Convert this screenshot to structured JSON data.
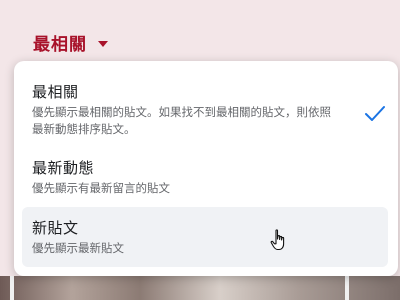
{
  "sort_menu": {
    "selected_label": "最相關",
    "options": [
      {
        "label": "最相關",
        "description": "優先顯示最相關的貼文。如果找不到最相關的貼文，則依照最新動態排序貼文。",
        "selected": true
      },
      {
        "label": "最新動態",
        "description": "優先顯示有最新留言的貼文",
        "selected": false
      },
      {
        "label": "新貼文",
        "description": "優先顯示最新貼文",
        "selected": false,
        "hovered": true
      }
    ]
  },
  "icons": {
    "caret": "chevron-down-icon",
    "check": "check-icon",
    "cursor": "hand-pointer-icon"
  },
  "colors": {
    "accent": "#a8122a",
    "check": "#1b74e4",
    "hover_bg": "#f0f2f5",
    "header_bg": "#f3e6e8"
  }
}
